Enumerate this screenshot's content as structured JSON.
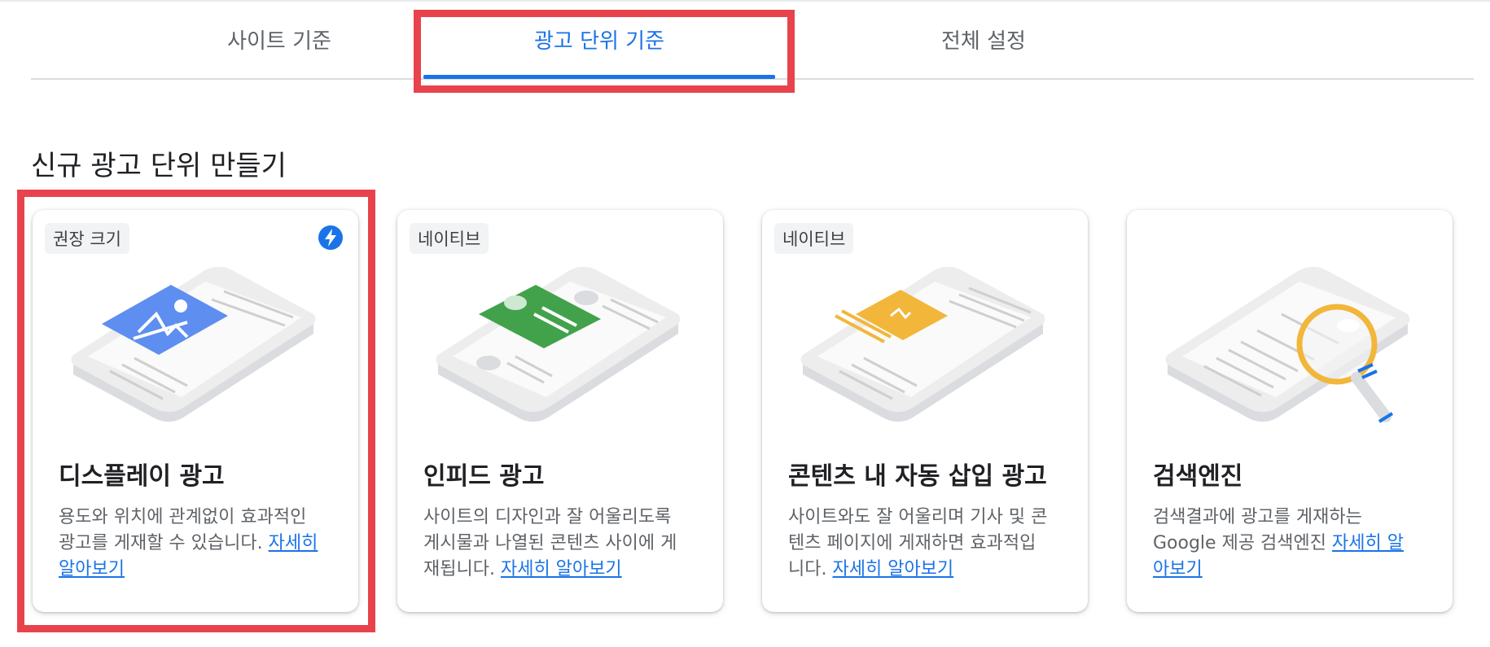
{
  "tabs": [
    {
      "label": "사이트 기준",
      "active": false
    },
    {
      "label": "광고 단위 기준",
      "active": true
    },
    {
      "label": "전체 설정",
      "active": false
    }
  ],
  "section_title": "신규 광고 단위 만들기",
  "cards": [
    {
      "badge": "권장 크기",
      "badge_icon": "lightning-bolt-icon",
      "title": "디스플레이 광고",
      "desc_lines": [
        "용도와 위치에 관계없이 효과적인",
        "광고를 게재할 수 있습니다."
      ],
      "link_part1": "자세히",
      "link_part2": "알아보기"
    },
    {
      "badge": "네이티브",
      "title": "인피드 광고",
      "desc_lines": [
        "사이트의 디자인과 잘 어울리도록",
        "게시물과 나열된 콘텐츠 사이에 게",
        "재됩니다."
      ],
      "link": "자세히 알아보기"
    },
    {
      "badge": "네이티브",
      "title": "콘텐츠 내 자동 삽입 광고",
      "desc_lines": [
        "사이트와도 잘 어울리며 기사 및 콘",
        "텐츠 페이지에 게재하면 효과적입",
        "니다."
      ],
      "link": "자세히 알아보기"
    },
    {
      "title": "검색엔진",
      "desc_lines": [
        "검색결과에 광고를 게재하는",
        "Google 제공 검색엔진"
      ],
      "link_part1": "자세히 알",
      "link_part2": "아보기"
    }
  ],
  "colors": {
    "accent": "#1a73e8",
    "highlight": "#e8434d",
    "display_ad": "#5e8ef0",
    "infeed_ad": "#42a24b",
    "inarticle_ad": "#f2b63a",
    "search_magnifier": "#f2b63a"
  }
}
